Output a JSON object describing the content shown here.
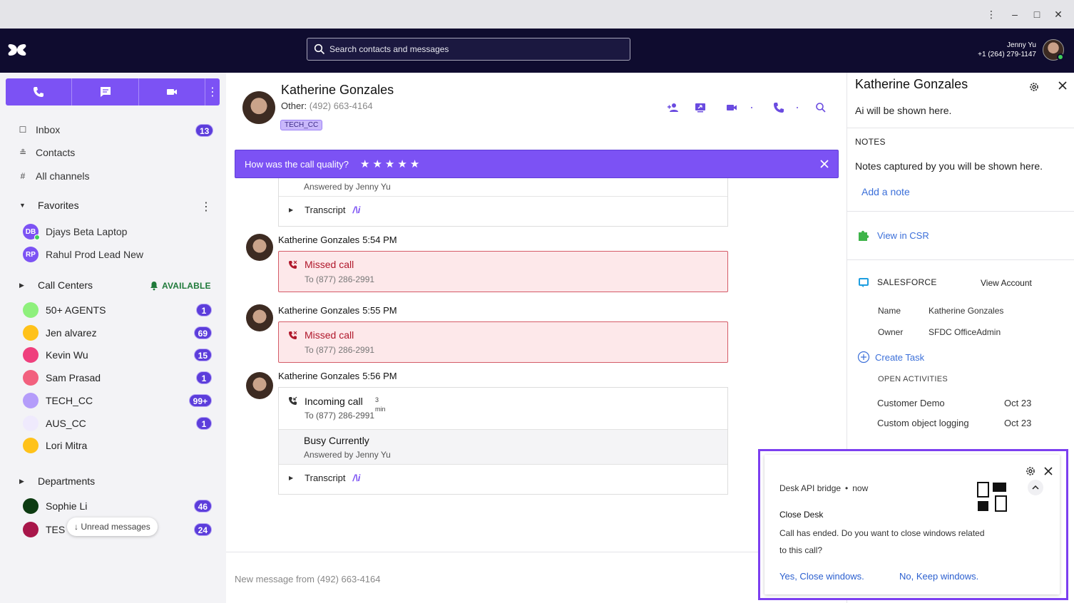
{
  "window": {
    "controls": {
      "more": "⋮",
      "minimize": "–",
      "maximize": "□",
      "close": "✕"
    }
  },
  "header": {
    "search_placeholder": "Search contacts and messages",
    "user": {
      "name": "Jenny Yu",
      "phone": "+1 (264) 279-1147"
    }
  },
  "sidebar": {
    "nav": [
      {
        "label": "Inbox",
        "badge": "13"
      },
      {
        "label": "Contacts"
      },
      {
        "label": "All channels"
      }
    ],
    "favorites": {
      "title": "Favorites",
      "items": [
        {
          "initials": "DB",
          "label": "Djays Beta Laptop"
        },
        {
          "initials": "RP",
          "label": "Rahul Prod Lead New"
        }
      ]
    },
    "call_centers": {
      "title": "Call Centers",
      "status": "AVAILABLE",
      "items": [
        {
          "label": "50+ AGENTS",
          "badge": "1",
          "color": "#8ef07c"
        },
        {
          "label": "Jen alvarez",
          "badge": "69",
          "color": "#ffc21a"
        },
        {
          "label": "Kevin Wu",
          "badge": "15",
          "color": "#ef3f7d"
        },
        {
          "label": "Sam Prasad",
          "badge": "1",
          "color": "#f2607e"
        },
        {
          "label": "TECH_CC",
          "badge": "99+",
          "color": "#b49cfa"
        },
        {
          "label": "AUS_CC",
          "badge": "1",
          "color": "#efeafd"
        },
        {
          "label": "Lori Mitra",
          "badge": "",
          "color": "#ffc21a"
        }
      ]
    },
    "departments": {
      "title": "Departments",
      "items": [
        {
          "label": "Sophie Li",
          "badge": "46",
          "color": "#0d3b12"
        },
        {
          "label": "TES",
          "badge": "24",
          "color": "#a8164a"
        }
      ]
    },
    "unread_chip": "↓ Unread messages"
  },
  "conversation": {
    "contact": {
      "name": "Katherine Gonzales",
      "phone_label": "Other:",
      "phone": "(492) 663-4164",
      "tag": "TECH_CC"
    },
    "quality": {
      "question": "How was the call quality?",
      "stars": "★"
    },
    "top_partial": {
      "answered": "Answered by Jenny Yu",
      "transcript": "Transcript"
    },
    "messages": [
      {
        "sender": "Katherine Gonzales",
        "time": "5:54 PM",
        "title": "Missed call",
        "sub": "To (877) 286-2991"
      },
      {
        "sender": "Katherine Gonzales",
        "time": "5:55 PM",
        "title": "Missed call",
        "sub": "To (877) 286-2991"
      }
    ],
    "incoming": {
      "sender": "Katherine Gonzales",
      "time": "5:56 PM",
      "title": "Incoming call",
      "duration": "3",
      "duration_unit": "min",
      "sub": "To (877) 286-2991",
      "status": "Busy Currently",
      "answered": "Answered by Jenny Yu",
      "transcript": "Transcript"
    },
    "ai_mark": "/\\i",
    "new_message_placeholder": "New message from (492) 663-4164"
  },
  "right_panel": {
    "title": "Katherine Gonzales",
    "ai_text": "Ai will be shown here.",
    "notes_title": "NOTES",
    "notes_text": "Notes captured by you will be shown here.",
    "add_note": "Add a note",
    "view_csr": "View in CSR",
    "salesforce": {
      "title": "SALESFORCE",
      "view_account": "View Account",
      "fields": [
        {
          "key": "Name",
          "value": "Katherine Gonzales"
        },
        {
          "key": "Owner",
          "value": "SFDC OfficeAdmin"
        }
      ],
      "create_task": "Create Task",
      "open_activities_title": "OPEN ACTIVITIES",
      "activities": [
        {
          "name": "Customer Demo",
          "date": "Oct 23"
        },
        {
          "name": "Custom object logging",
          "date": "Oct 23"
        }
      ]
    }
  },
  "notification": {
    "source": "Desk API bridge",
    "separator": "•",
    "time": "now",
    "title": "Close Desk",
    "body": "Call has ended. Do you want to close windows related to this call?",
    "yes": "Yes, Close windows.",
    "no": "No, Keep windows."
  }
}
